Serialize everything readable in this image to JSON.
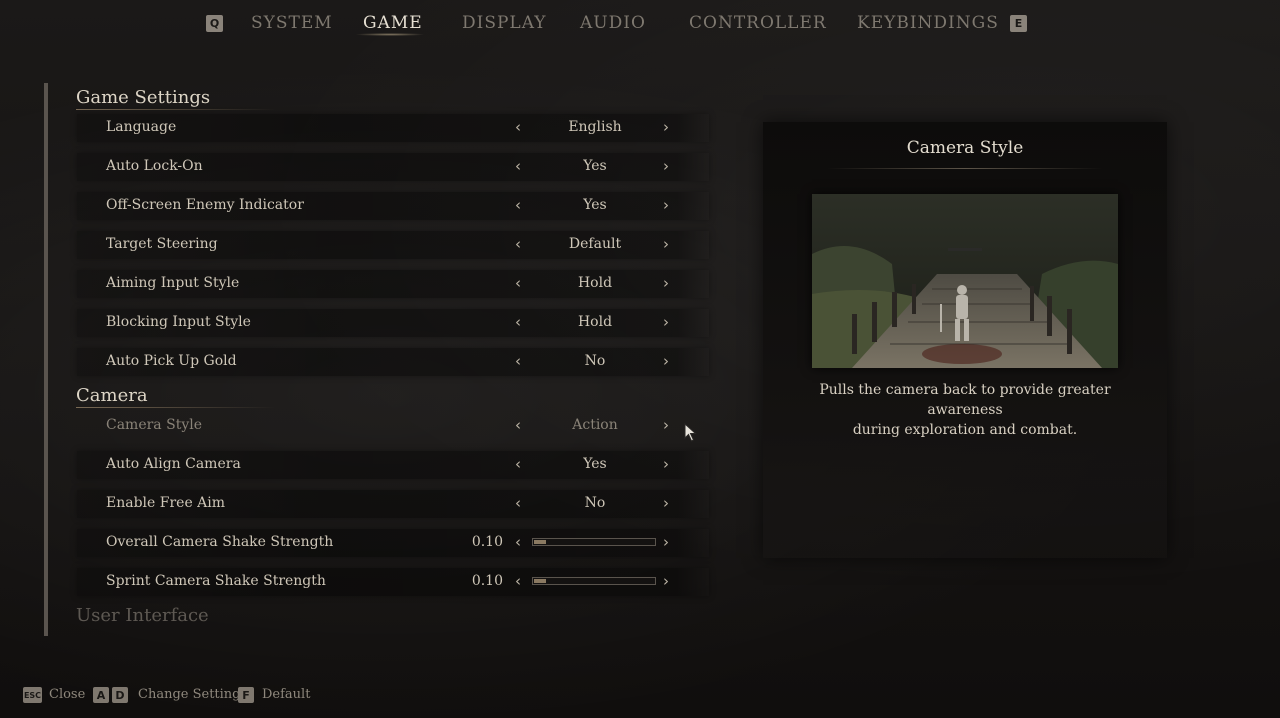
{
  "tabs": {
    "prev_key": "Q",
    "next_key": "E",
    "items": [
      {
        "label": "SYSTEM"
      },
      {
        "label": "GAME"
      },
      {
        "label": "DISPLAY"
      },
      {
        "label": "AUDIO"
      },
      {
        "label": "CONTROLLER"
      },
      {
        "label": "KEYBINDINGS"
      }
    ],
    "active": "GAME"
  },
  "sections": {
    "game_settings": "Game Settings",
    "camera": "Camera",
    "user_interface": "User Interface"
  },
  "game_rows": [
    {
      "label": "Language",
      "value": "English"
    },
    {
      "label": "Auto Lock-On",
      "value": "Yes"
    },
    {
      "label": "Off-Screen Enemy Indicator",
      "value": "Yes"
    },
    {
      "label": "Target Steering",
      "value": "Default"
    },
    {
      "label": "Aiming Input Style",
      "value": "Hold"
    },
    {
      "label": "Blocking Input Style",
      "value": "Hold"
    },
    {
      "label": "Auto Pick Up Gold",
      "value": "No"
    }
  ],
  "camera_rows": [
    {
      "label": "Camera Style",
      "value": "Action"
    },
    {
      "label": "Auto Align Camera",
      "value": "Yes"
    },
    {
      "label": "Enable Free Aim",
      "value": "No"
    }
  ],
  "slider_rows": [
    {
      "label": "Overall Camera Shake Strength",
      "value": "0.10",
      "level": 0.1
    },
    {
      "label": "Sprint Camera Shake Strength",
      "value": "0.10",
      "level": 0.1
    }
  ],
  "info": {
    "title": "Camera Style",
    "description_line1": "Pulls the camera back to provide greater awareness",
    "description_line2": "during exploration and combat."
  },
  "hints": {
    "close_key": "ESC",
    "close_label": "Close",
    "change_key_a": "A",
    "change_key_d": "D",
    "change_label": "Change Setting",
    "default_key": "F",
    "default_label": "Default"
  },
  "colors": {
    "accent": "#8b7a62",
    "text": "#cfc7b8",
    "background": "#141211"
  }
}
